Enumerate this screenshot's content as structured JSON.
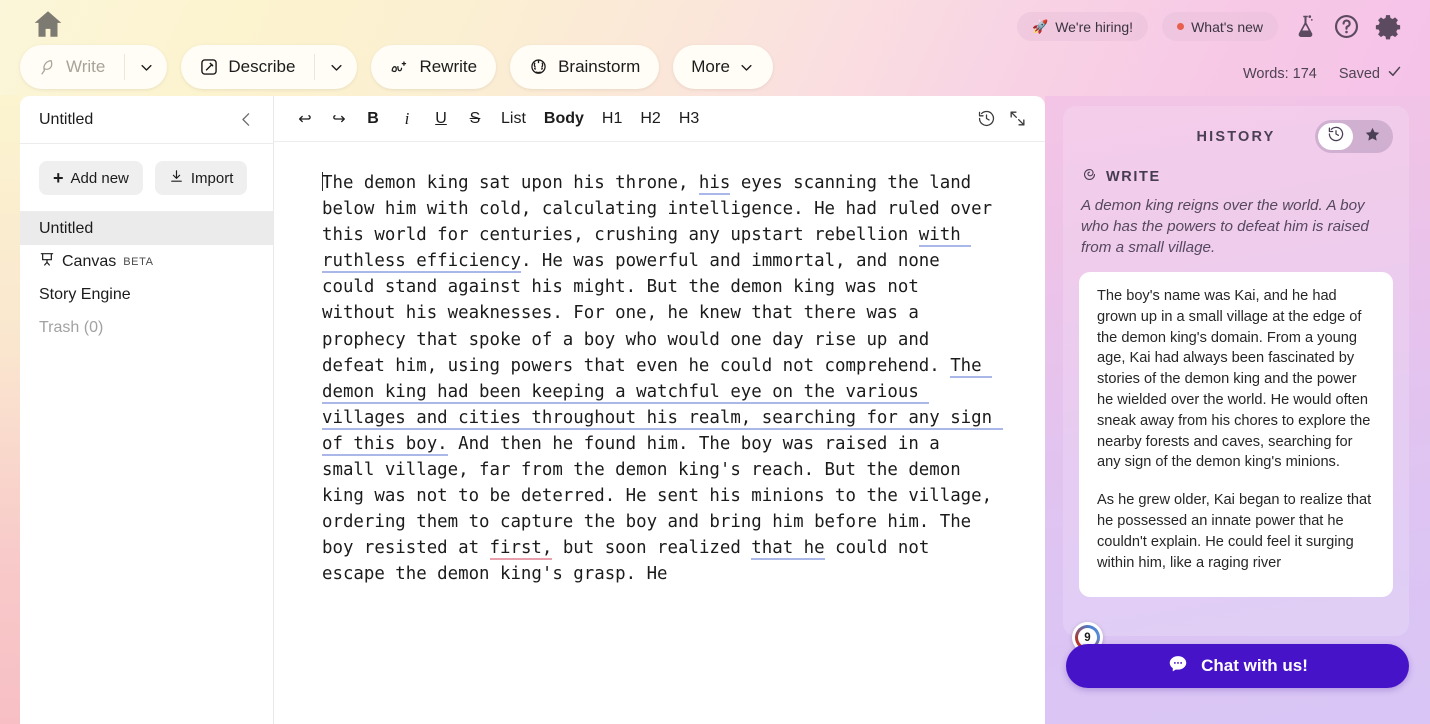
{
  "header": {
    "home_icon": "home-icon",
    "tools": [
      {
        "label": "Write",
        "icon": "feather-icon",
        "disabled": true,
        "has_caret": true
      },
      {
        "label": "Describe",
        "icon": "describe-icon",
        "disabled": false,
        "has_caret": true
      },
      {
        "label": "Rewrite",
        "icon": "rewrite-icon",
        "disabled": false,
        "has_caret": false
      },
      {
        "label": "Brainstorm",
        "icon": "brain-icon",
        "disabled": false,
        "has_caret": false
      },
      {
        "label": "More",
        "icon": "",
        "disabled": false,
        "has_caret": true
      }
    ],
    "hiring_chip": "We're hiring!",
    "hiring_emoji": "🚀",
    "whats_new_chip": "What's new",
    "icons": [
      "flask-icon",
      "help-icon",
      "gear-icon"
    ],
    "word_count": "Words: 174",
    "saved_label": "Saved"
  },
  "sidebar": {
    "title": "Untitled",
    "collapse_icon": "chevron-left-icon",
    "add_new_label": "Add new",
    "import_label": "Import",
    "items": [
      {
        "label": "Untitled",
        "active": true,
        "icon": "",
        "badge": "",
        "muted": false
      },
      {
        "label": "Canvas",
        "active": false,
        "icon": "canvas-icon",
        "badge": "BETA",
        "muted": false
      },
      {
        "label": "Story Engine",
        "active": false,
        "icon": "",
        "badge": "",
        "muted": false
      },
      {
        "label": "Trash (0)",
        "active": false,
        "icon": "",
        "badge": "",
        "muted": true
      }
    ]
  },
  "editor": {
    "toolbar": {
      "undo": "↩",
      "redo": "↪",
      "bold": "B",
      "italic": "i",
      "underline": "U",
      "strike": "S",
      "list": "List",
      "body": "Body",
      "h1": "H1",
      "h2": "H2",
      "h3": "H3",
      "history_icon": "history-clock-icon",
      "expand_icon": "expand-arrows-icon"
    },
    "segments": [
      {
        "text": "The demon king sat upon his throne, ",
        "style": "none"
      },
      {
        "text": "his",
        "style": "blue"
      },
      {
        "text": " eyes scanning the land below him with cold, calculating intelligence. He had ruled over this world for centuries, crushing any upstart rebellion ",
        "style": "none"
      },
      {
        "text": "with ruthless efficiency",
        "style": "blue"
      },
      {
        "text": ". He was powerful and immortal, and none could stand against his might. But the demon king was not without his weaknesses. For one, he knew that there was a prophecy that spoke of a boy who would one day rise up and defeat him, using powers that even he could not comprehend. ",
        "style": "none"
      },
      {
        "text": "The demon king had been keeping a watchful eye on the various villages and cities throughout his realm, searching for any sign of this boy.",
        "style": "blue"
      },
      {
        "text": " And then he found him. The boy was raised in a small village, far from the demon king's reach. But the demon king was not to be deterred. He sent his minions to the village, ordering them to capture the boy and bring him before him. The boy resisted at ",
        "style": "none"
      },
      {
        "text": "first,",
        "style": "red"
      },
      {
        "text": " but soon realized ",
        "style": "none"
      },
      {
        "text": "that he",
        "style": "blue"
      },
      {
        "text": " could not escape the demon king's grasp. He",
        "style": "none"
      }
    ]
  },
  "history": {
    "panel_title": "HISTORY",
    "toggle": [
      {
        "icon": "history-clock-icon",
        "selected": true
      },
      {
        "icon": "star-icon",
        "selected": false
      }
    ],
    "entry_type_icon": "sudowrite-spiral-icon",
    "entry_type": "WRITE",
    "prompt": "A demon king reigns over the world. A boy who has the powers to defeat him is raised from a small village.",
    "generation_paragraphs": [
      "The boy's name was Kai, and he had grown up in a small village at the edge of the demon king's domain. From a young age, Kai had always been fascinated by stories of the demon king and the power he wielded over the world. He would often sneak away from his chores to explore the nearby forests and caves, searching for any sign of the demon king's minions.",
      "As he grew older, Kai began to realize that he possessed an innate power that he couldn't explain. He could feel it surging within him, like a raging river"
    ],
    "badge_count": "9",
    "chat_label": "Chat with us!",
    "chat_icon": "chat-bubble-icon"
  },
  "colors": {
    "accent_purple": "#4713c9",
    "suggestion_blue": "#a9b8e8",
    "suggestion_red": "#e8a0ac",
    "panel_pink": "#f3c4e6",
    "panel_lavender": "#d9c6f6"
  }
}
